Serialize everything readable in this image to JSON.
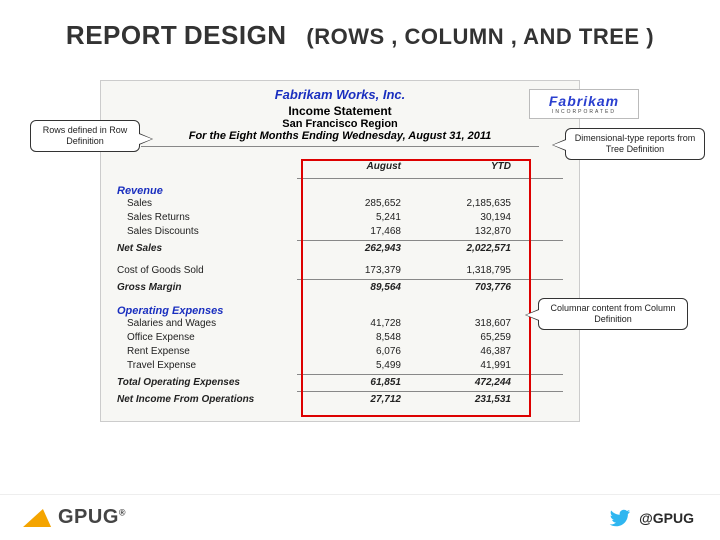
{
  "title_parts": {
    "w1": "REPORT",
    "w2": "DESIGN",
    "w3": "(ROWS ,",
    "w4": "COLUMN",
    "w5": ", AND",
    "w6": "TREE",
    "w7": ")"
  },
  "report": {
    "company": "Fabrikam Works, Inc.",
    "title": "Income Statement",
    "region": "San Francisco Region",
    "period": "For the Eight Months Ending Wednesday, August 31, 2011",
    "logo_name": "Fabrikam",
    "logo_sub": "INCORPORATED",
    "col1": "August",
    "col2": "YTD",
    "sections": {
      "revenue_head": "Revenue",
      "sales": {
        "label": "Sales",
        "c1": "285,652",
        "c2": "2,185,635"
      },
      "sales_returns": {
        "label": "Sales Returns",
        "c1": "5,241",
        "c2": "30,194"
      },
      "sales_discounts": {
        "label": "Sales Discounts",
        "c1": "17,468",
        "c2": "132,870"
      },
      "net_sales": {
        "label": "Net Sales",
        "c1": "262,943",
        "c2": "2,022,571"
      },
      "cogs": {
        "label": "Cost of Goods Sold",
        "c1": "173,379",
        "c2": "1,318,795"
      },
      "gross_margin": {
        "label": "Gross Margin",
        "c1": "89,564",
        "c2": "703,776"
      },
      "opex_head": "Operating Expenses",
      "salaries": {
        "label": "Salaries and Wages",
        "c1": "41,728",
        "c2": "318,607"
      },
      "office": {
        "label": "Office Expense",
        "c1": "8,548",
        "c2": "65,259"
      },
      "rent": {
        "label": "Rent Expense",
        "c1": "6,076",
        "c2": "46,387"
      },
      "travel": {
        "label": "Travel Expense",
        "c1": "5,499",
        "c2": "41,991"
      },
      "total_opex": {
        "label": "Total Operating Expenses",
        "c1": "61,851",
        "c2": "472,244"
      },
      "net_income": {
        "label": "Net Income From Operations",
        "c1": "27,712",
        "c2": "231,531"
      }
    }
  },
  "callouts": {
    "c1": "Rows defined in Row Definition",
    "c2": "Dimensional-type reports from Tree Definition",
    "c3": "Columnar content from Column Definition"
  },
  "footer": {
    "logo_text": "GPUG",
    "reg": "®",
    "handle": "@GPUG"
  }
}
